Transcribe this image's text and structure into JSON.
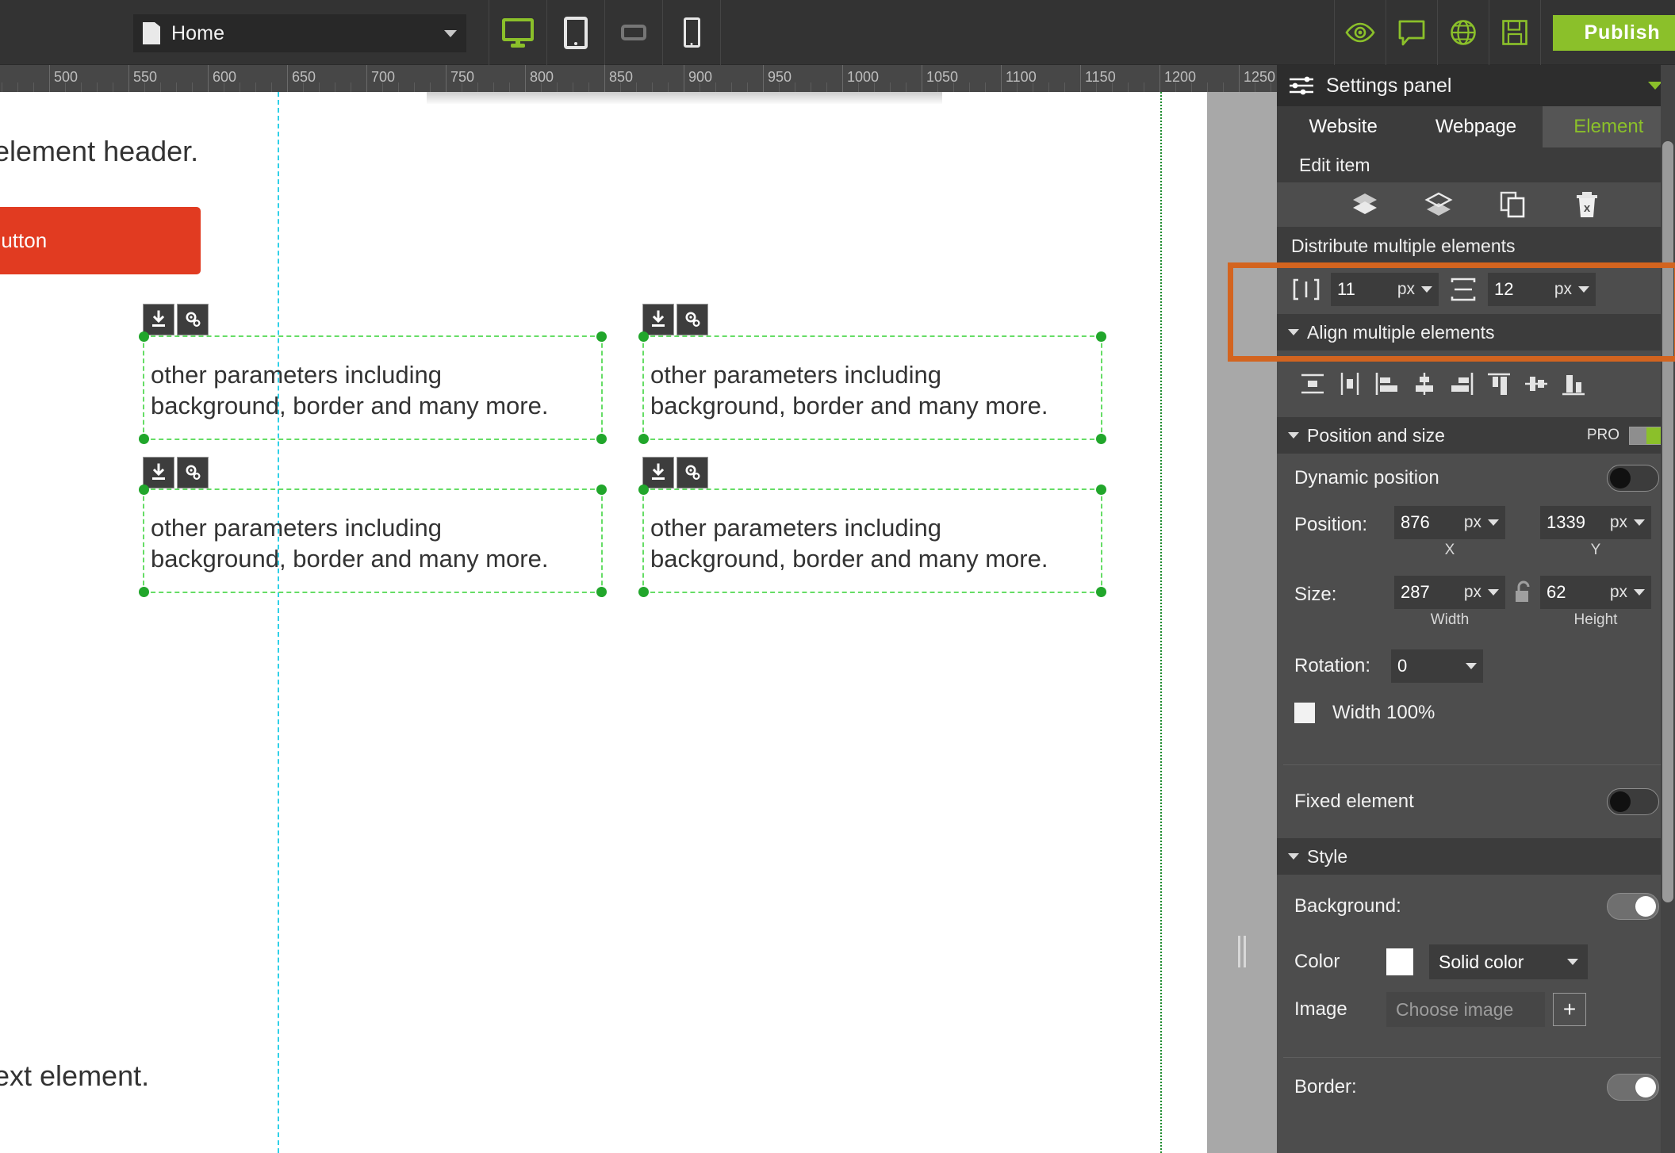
{
  "toolbar": {
    "page_name": "Home",
    "page_icon": "document-icon",
    "devices": [
      {
        "name": "desktop",
        "icon": "monitor-icon",
        "active": true
      },
      {
        "name": "tablet",
        "icon": "tablet-icon",
        "active": false
      },
      {
        "name": "tablet-landscape",
        "icon": "tablet-landscape-icon",
        "active": false
      },
      {
        "name": "mobile",
        "icon": "phone-icon",
        "active": false
      }
    ],
    "actions": [
      {
        "name": "preview",
        "icon": "eye-icon"
      },
      {
        "name": "comments",
        "icon": "speech-bubble-icon"
      },
      {
        "name": "language",
        "icon": "globe-icon"
      },
      {
        "name": "save",
        "icon": "floppy-disk-icon"
      }
    ],
    "publish_label": "Publish"
  },
  "ruler": {
    "unit": "px",
    "labels": [
      500,
      550,
      600,
      650,
      700,
      750,
      800,
      850,
      900,
      950,
      1000,
      1050,
      1100,
      1150,
      1200,
      1250
    ]
  },
  "canvas": {
    "header_text": "element header.",
    "button_label": "Button",
    "footer_text": "ext element.",
    "elements": [
      {
        "text_line1": "other parameters including",
        "text_line2": "background, border and many more."
      },
      {
        "text_line1": "other parameters including",
        "text_line2": "background, border and many more."
      },
      {
        "text_line1": "other parameters including",
        "text_line2": "background, border and many more."
      },
      {
        "text_line1": "other parameters including",
        "text_line2": "background, border and many more."
      }
    ],
    "element_tools": [
      {
        "name": "download-icon"
      },
      {
        "name": "settings-gears-icon"
      }
    ]
  },
  "panel": {
    "title": "Settings panel",
    "title_icon": "sliders-icon",
    "collapse_icon": "chevron-down-icon",
    "tabs": [
      {
        "label": "Website",
        "active": false
      },
      {
        "label": "Webpage",
        "active": false
      },
      {
        "label": "Element",
        "active": true
      }
    ],
    "edit_item": {
      "label": "Edit item",
      "icons": [
        {
          "name": "send-to-back-icon"
        },
        {
          "name": "bring-to-front-icon"
        },
        {
          "name": "duplicate-icon"
        },
        {
          "name": "delete-icon"
        }
      ]
    },
    "distribute": {
      "title": "Distribute multiple elements",
      "horizontal": {
        "icon": "distribute-horizontal-icon",
        "value": "11",
        "unit": "px"
      },
      "vertical": {
        "icon": "distribute-vertical-icon",
        "value": "12",
        "unit": "px"
      },
      "highlighted": true,
      "highlight_color": "#d3641f"
    },
    "align": {
      "title": "Align multiple elements",
      "icons": [
        {
          "name": "align-center-horizontal-icon"
        },
        {
          "name": "align-center-vertical-icon"
        },
        {
          "name": "align-left-icon"
        },
        {
          "name": "align-horizontal-center-icon"
        },
        {
          "name": "align-right-icon"
        },
        {
          "name": "align-top-icon"
        },
        {
          "name": "align-vertical-center-icon"
        },
        {
          "name": "align-bottom-icon"
        }
      ]
    },
    "position_size": {
      "title": "Position and size",
      "pro_label": "PRO",
      "dynamic_position_label": "Dynamic position",
      "dynamic_position_on": false,
      "position_label": "Position:",
      "pos_x": {
        "value": "876",
        "unit": "px",
        "sub": "X"
      },
      "pos_y": {
        "value": "1339",
        "unit": "px",
        "sub": "Y"
      },
      "size_label": "Size:",
      "width": {
        "value": "287",
        "unit": "px",
        "sub": "Width"
      },
      "height": {
        "value": "62",
        "unit": "px",
        "sub": "Height"
      },
      "lock_icon": "unlocked-padlock-icon",
      "rotation_label": "Rotation:",
      "rotation": {
        "value": "0"
      },
      "width100_label": "Width 100%",
      "width100_checked": false
    },
    "fixed_element": {
      "label": "Fixed element",
      "on": false
    },
    "style": {
      "title": "Style",
      "background_label": "Background:",
      "background_on": true,
      "color_label": "Color",
      "color_value": "#ffffff",
      "color_mode": "Solid color",
      "image_label": "Image",
      "image_placeholder": "Choose image",
      "add_image_label": "+",
      "border_label": "Border:",
      "border_on": true
    }
  },
  "colors": {
    "accent_green": "#8bc02a",
    "highlight_orange": "#d3641f",
    "button_red": "#e13b21",
    "guide_cyan": "#2fd0e8",
    "selection_green": "#21a62b"
  }
}
